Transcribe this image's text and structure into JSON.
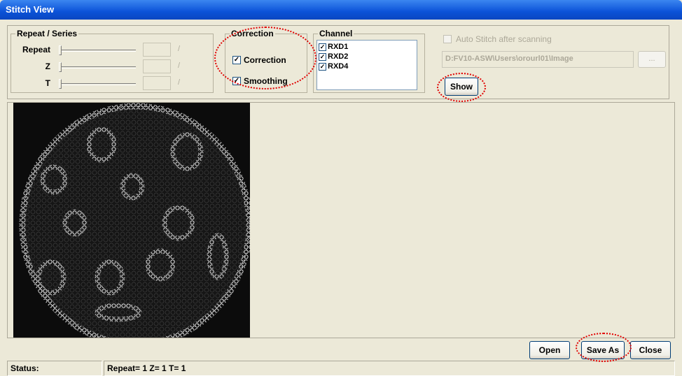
{
  "window": {
    "title": "Stitch View"
  },
  "repeat_series": {
    "legend": "Repeat / Series",
    "rows": [
      {
        "label": "Repeat",
        "separator": "/"
      },
      {
        "label": "Z",
        "separator": "/"
      },
      {
        "label": "T",
        "separator": "/"
      }
    ]
  },
  "correction": {
    "legend": "Correction",
    "options": [
      {
        "label": "Correction",
        "checked": true
      },
      {
        "label": "Smoothing",
        "checked": true
      }
    ]
  },
  "channel": {
    "legend": "Channel",
    "items": [
      {
        "label": "RXD1",
        "checked": true
      },
      {
        "label": "RXD2",
        "checked": true
      },
      {
        "label": "RXD4",
        "checked": true
      }
    ]
  },
  "auto_stitch": {
    "label": "Auto Stitch after scanning",
    "checked": false,
    "enabled": false
  },
  "path": {
    "value": "D:FV10-ASW\\Users\\orourl01\\Image",
    "browse_label": "..."
  },
  "buttons": {
    "show": "Show",
    "open": "Open",
    "save_as": "Save As",
    "close": "Close"
  },
  "status": {
    "label": "Status:",
    "value": "Repeat= 1   Z= 1   T= 1"
  },
  "colors": {
    "annotation": "#e00000",
    "title_bar": "#0b52d8"
  }
}
